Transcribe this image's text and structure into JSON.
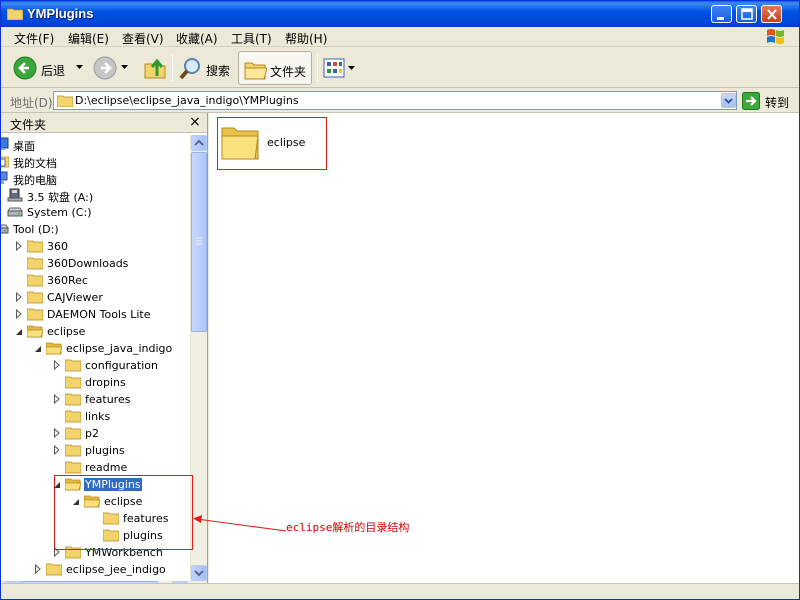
{
  "window": {
    "title": "YMPlugins"
  },
  "menu": [
    {
      "label": "文件(F)"
    },
    {
      "label": "编辑(E)"
    },
    {
      "label": "查看(V)"
    },
    {
      "label": "收藏(A)"
    },
    {
      "label": "工具(T)"
    },
    {
      "label": "帮助(H)"
    }
  ],
  "toolbar": {
    "back": "后退",
    "search": "搜索",
    "folders": "文件夹"
  },
  "address": {
    "label": "地址(D)",
    "value": "D:\\eclipse\\eclipse_java_indigo\\YMPlugins",
    "go": "转到"
  },
  "folder_pane": {
    "title": "文件夹",
    "close": "×",
    "tree": [
      {
        "label": "桌面",
        "icon": "desktop-icon",
        "expander": "none"
      },
      {
        "label": "我的文档",
        "icon": "my-documents-icon",
        "expander": "none"
      },
      {
        "label": "我的电脑",
        "icon": "my-computer-icon",
        "expander": "none"
      },
      {
        "label": "3.5 软盘 (A:)",
        "icon": "floppy-icon",
        "expander": "none"
      },
      {
        "label": "System (C:)",
        "icon": "drive-icon",
        "expander": "none"
      },
      {
        "label": "Tool (D:)",
        "icon": "drive-icon",
        "expander": "open"
      },
      {
        "label": "360",
        "icon": "folder-icon",
        "expander": "closed"
      },
      {
        "label": "360Downloads",
        "icon": "folder-icon",
        "expander": "none"
      },
      {
        "label": "360Rec",
        "icon": "folder-icon",
        "expander": "none"
      },
      {
        "label": "CAJViewer",
        "icon": "folder-icon",
        "expander": "closed"
      },
      {
        "label": "DAEMON Tools Lite",
        "icon": "folder-icon",
        "expander": "closed"
      },
      {
        "label": "eclipse",
        "icon": "folder-open-icon",
        "expander": "open"
      },
      {
        "label": "eclipse_java_indigo",
        "icon": "folder-open-icon",
        "expander": "open"
      },
      {
        "label": "configuration",
        "icon": "folder-icon",
        "expander": "closed"
      },
      {
        "label": "dropins",
        "icon": "folder-icon",
        "expander": "none"
      },
      {
        "label": "features",
        "icon": "folder-icon",
        "expander": "closed"
      },
      {
        "label": "links",
        "icon": "folder-icon",
        "expander": "none"
      },
      {
        "label": "p2",
        "icon": "folder-icon",
        "expander": "closed"
      },
      {
        "label": "plugins",
        "icon": "folder-icon",
        "expander": "closed"
      },
      {
        "label": "readme",
        "icon": "folder-icon",
        "expander": "none"
      },
      {
        "label": "YMPlugins",
        "icon": "folder-open-icon",
        "expander": "open",
        "selected": true
      },
      {
        "label": "eclipse",
        "icon": "folder-open-icon",
        "expander": "open"
      },
      {
        "label": "features",
        "icon": "folder-icon",
        "expander": "none"
      },
      {
        "label": "plugins",
        "icon": "folder-icon",
        "expander": "none"
      },
      {
        "label": "YMWorkbench",
        "icon": "folder-icon",
        "expander": "closed"
      },
      {
        "label": "eclipse_jee_indigo",
        "icon": "folder-icon",
        "expander": "closed"
      }
    ]
  },
  "content": {
    "items": [
      {
        "label": "eclipse",
        "icon": "folder-large-icon"
      }
    ]
  },
  "annotation": {
    "text": "eclipse解析的目录结构",
    "color": "#d40000"
  },
  "colors": {
    "titlebar": "#0054e3",
    "selection": "#316ac5",
    "annotation_red": "#e21c1c"
  }
}
